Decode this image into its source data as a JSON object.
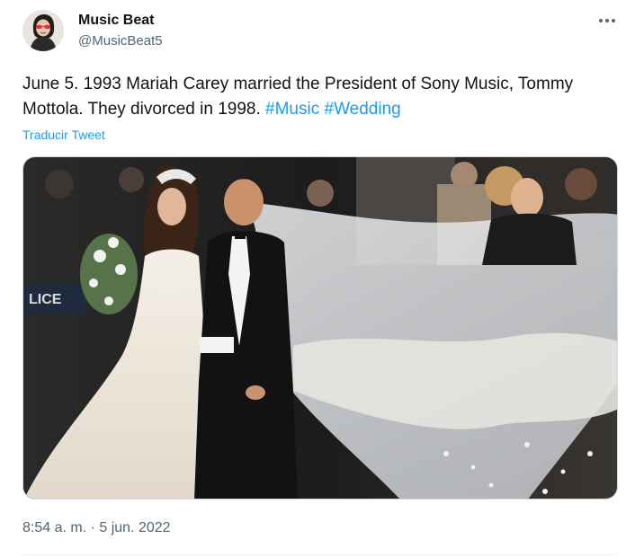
{
  "author": {
    "display_name": "Music Beat",
    "handle": "@MusicBeat5",
    "avatar_icon": "avatar-illustration"
  },
  "tweet": {
    "text_before": "June 5. 1993 Mariah Carey married the President of Sony Music, Tommy Mottola. They divorced in 1998.",
    "hashtags": [
      "#Music",
      "#Wedding"
    ],
    "translate_label": "Traducir Tweet",
    "timestamp": "8:54 a. m. · 5 jun. 2022",
    "photo_sign_text": "LICE"
  },
  "colors": {
    "link": "#1d9bf0",
    "secondary_text": "#536471",
    "primary_text": "#0f1419"
  },
  "icons": {
    "more": "more-horizontal-icon"
  }
}
